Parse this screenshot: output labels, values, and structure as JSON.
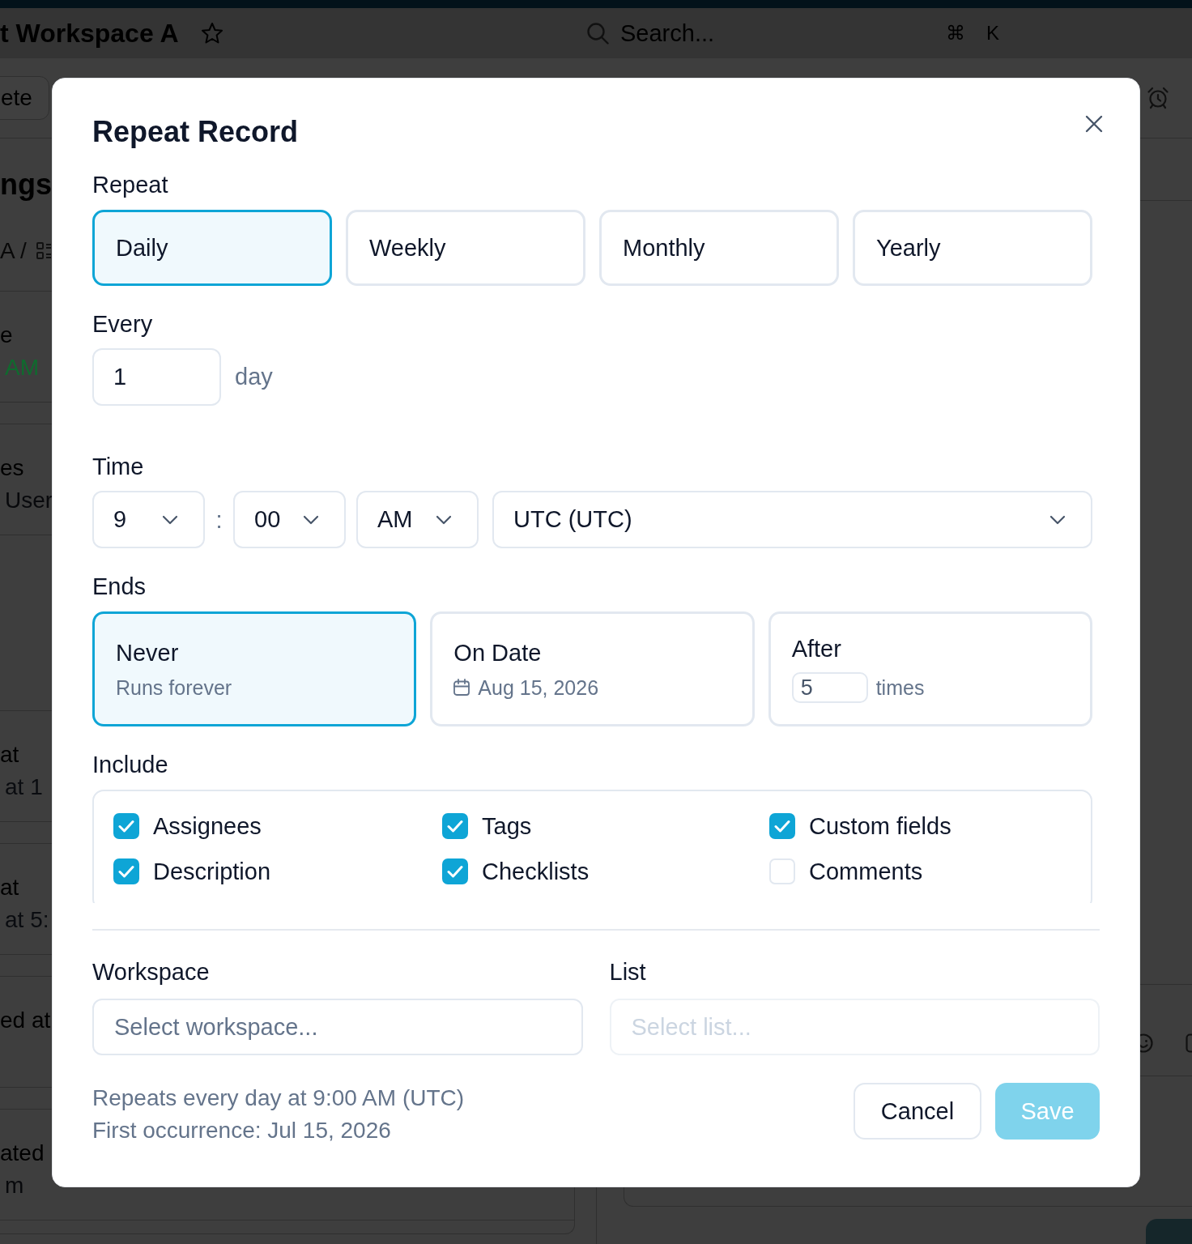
{
  "background": {
    "header": {
      "title": "t Workspace A",
      "search": {
        "placeholder": "Search..."
      },
      "shortcut_keys": [
        "⌘",
        "K"
      ]
    },
    "toolbar": {
      "button": "ete"
    },
    "panel": {
      "heading": "ngs",
      "breadcrumb": "A /",
      "rows": [
        {
          "title": "e",
          "subtitle": "AM",
          "color": "#0f6b2e"
        },
        {
          "title": "es",
          "subtitle": "User",
          "color": "#08090c"
        },
        {
          "title": "at",
          "subtitle": "at 1",
          "color": "#0a0c10"
        },
        {
          "title": "at",
          "subtitle": "at 5:",
          "color": "#0a0c10"
        },
        {
          "title": "ed at"
        },
        {
          "title": "ated",
          "subtitle": "m",
          "color": "#08090c"
        }
      ]
    }
  },
  "dialog": {
    "title": "Repeat Record",
    "repeat": {
      "label": "Repeat",
      "options": [
        {
          "label": "Daily",
          "selected": true
        },
        {
          "label": "Weekly",
          "selected": false
        },
        {
          "label": "Monthly",
          "selected": false
        },
        {
          "label": "Yearly",
          "selected": false
        }
      ]
    },
    "every": {
      "label": "Every",
      "value": "1",
      "unit": "day"
    },
    "time": {
      "label": "Time",
      "hour": "9",
      "separator": ":",
      "minute": "00",
      "period": "AM",
      "timezone": "UTC (UTC)"
    },
    "ends": {
      "label": "Ends",
      "options": [
        {
          "kind": "never",
          "title": "Never",
          "detail": "Runs forever",
          "selected": true
        },
        {
          "kind": "date",
          "title": "On Date",
          "detail": "Aug 15, 2026",
          "selected": false
        },
        {
          "kind": "count",
          "title": "After",
          "value": "5",
          "unit": "times",
          "selected": false
        }
      ]
    },
    "include": {
      "label": "Include",
      "items": [
        {
          "label": "Assignees",
          "checked": true
        },
        {
          "label": "Tags",
          "checked": true
        },
        {
          "label": "Custom fields",
          "checked": true
        },
        {
          "label": "Description",
          "checked": true
        },
        {
          "label": "Checklists",
          "checked": true
        },
        {
          "label": "Comments",
          "checked": false
        }
      ]
    },
    "workspace": {
      "label": "Workspace",
      "placeholder": "Select workspace...",
      "disabled": false
    },
    "list": {
      "label": "List",
      "placeholder": "Select list...",
      "disabled": true
    },
    "summary": [
      "Repeats every day at 9:00 AM (UTC)",
      "First occurrence: Jul 15, 2026"
    ],
    "buttons": [
      {
        "kind": "secondary",
        "label": "Cancel",
        "disabled": false
      },
      {
        "kind": "primary",
        "label": "Save",
        "disabled": true
      }
    ]
  }
}
